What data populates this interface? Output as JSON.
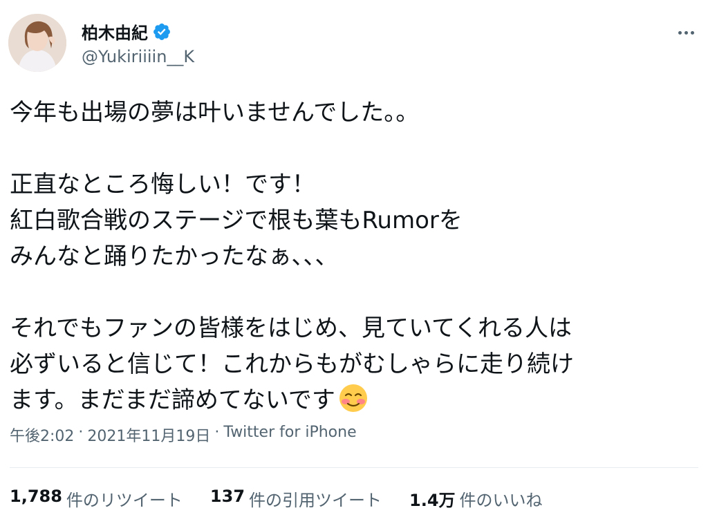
{
  "user": {
    "display_name": "柏木由紀",
    "handle": "@Yukiriiiin__K",
    "verified": true,
    "avatar_icon": "profile-photo"
  },
  "more_icon": "more-horizontal-icon",
  "tweet": {
    "text": "今年も出場の夢は叶いませんでした。。\n\n正直なところ悔しい！です！\n紅白歌合戦のステージで根も葉もRumorを\nみんなと踊りたかったなぁ、、、\n\nそれでもファンの皆様をはじめ、見ていてくれる人は\n必ずいると信じて！これからもがむしゃらに走り続け\nます。まだまだ諦めてないです",
    "emoji": "smiling-face-with-blush-emoji"
  },
  "meta": {
    "time": "午後2:02",
    "separator1": "·",
    "date": "2021年11月19日",
    "separator2": "·",
    "source": "Twitter for iPhone"
  },
  "stats": {
    "retweets": {
      "count": "1,788",
      "label": "件のリツイート"
    },
    "quotes": {
      "count": "137",
      "label": "件の引用ツイート"
    },
    "likes": {
      "count": "1.4万",
      "label": "件のいいね"
    }
  },
  "colors": {
    "text_primary": "#0f1419",
    "text_secondary": "#536471",
    "verified_blue": "#1d9bf0",
    "divider": "#e6ecf0"
  }
}
